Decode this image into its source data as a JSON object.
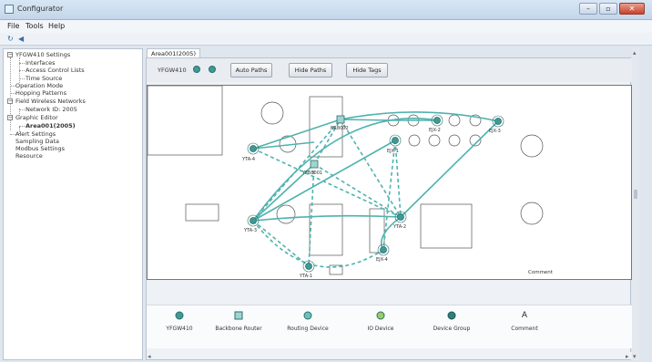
{
  "window": {
    "title": "Configurator",
    "minimize": "–",
    "maximize": "▫",
    "close": "✕"
  },
  "menu": [
    "File",
    "Tools",
    "Help"
  ],
  "toolbar_icons": [
    "refresh-icon",
    "speaker-icon"
  ],
  "tree": {
    "items": [
      {
        "label": "YFGW410 Settings",
        "level": 0,
        "toggle": "−"
      },
      {
        "label": "Interfaces",
        "level": 2
      },
      {
        "label": "Access Control Lists",
        "level": 2
      },
      {
        "label": "Time Source",
        "level": 2
      },
      {
        "label": "Operation Mode",
        "level": 1
      },
      {
        "label": "Hopping Patterns",
        "level": 1
      },
      {
        "label": "Field Wireless Networks",
        "level": 0,
        "toggle": "−"
      },
      {
        "label": "Network ID: 2005",
        "level": 2
      },
      {
        "label": "Graphic Editor",
        "level": 0,
        "toggle": "−"
      },
      {
        "label": "Area001(2005)",
        "level": 2,
        "bold": true
      },
      {
        "label": "Alert Settings",
        "level": 1
      },
      {
        "label": "Sampling Data",
        "level": 1
      },
      {
        "label": "Modbus Settings",
        "level": 1
      },
      {
        "label": "Resource",
        "level": 1
      }
    ]
  },
  "tab": "Area001(2005)",
  "editor": {
    "device": "YFGW410",
    "buttons": {
      "auto_paths": "Auto Paths",
      "hide_paths": "Hide Paths",
      "hide_tags": "Hide Tags"
    },
    "comment": "Comment",
    "node_labels": {
      "yta4": "YTA-4",
      "yta3": "YTA-3",
      "yta1": "YTA-1",
      "yta2": "YTA-2",
      "br1": "BR8002",
      "br2": "YFB8001",
      "ejx1": "EJX-1",
      "ejx2": "EJX-2",
      "ejx3": "EJX-3",
      "ejx4": "EJX-4"
    }
  },
  "palette": [
    {
      "label": "YFGW410",
      "icon": "gateway-icon"
    },
    {
      "label": "Backbone Router",
      "icon": "backbone-router-icon"
    },
    {
      "label": "Routing Device",
      "icon": "routing-device-icon"
    },
    {
      "label": "IO Device",
      "icon": "io-device-icon"
    },
    {
      "label": "Device Group",
      "icon": "device-group-icon"
    },
    {
      "label": "Comment",
      "icon": "comment-icon",
      "glyph": "A"
    }
  ],
  "colors": {
    "path": "#4fb3ae",
    "node_fill": "#3f9a95",
    "node_stroke": "#2b6f6b"
  }
}
